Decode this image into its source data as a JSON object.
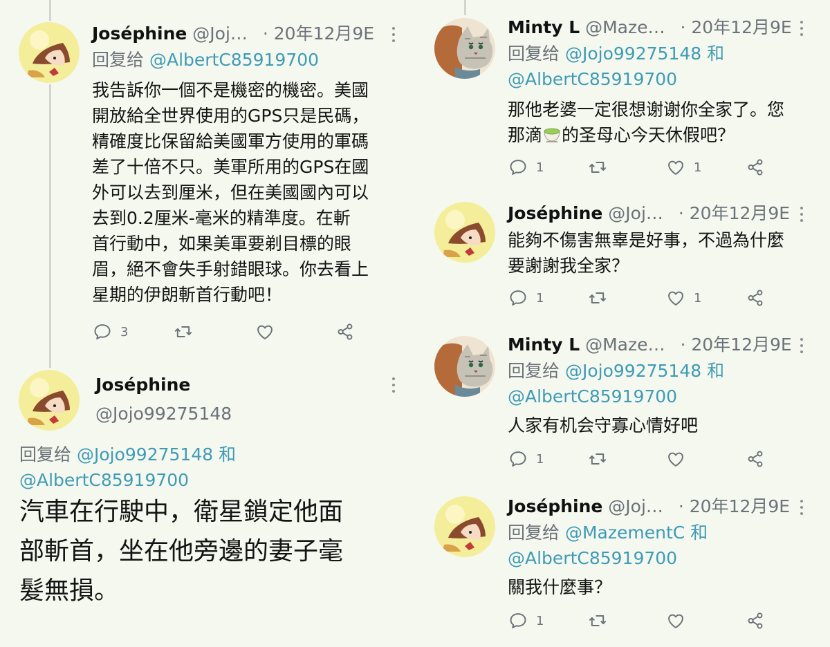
{
  "left_top": {
    "author_name": "Joséphine",
    "author_handle": "@Joj…",
    "date": "· 20年12月9E",
    "reply_prefix": "回复给",
    "reply_to": "@AlbertC85919700",
    "lines": [
      "我告訴你一個不是機密的機密。美國",
      "開放給全世界使用的GPS只是民碼，",
      "精確度比保留給美國軍方使用的軍碼",
      "差了十倍不只。美軍所用的GPS在國",
      "外可以去到厘米，但在美國國內可以",
      "去到0.2厘米-毫米的精準度。在斬",
      "首行動中，如果美軍要剃目標的眼",
      "眉，絕不會失手射錯眼球。你去看上",
      "星期的伊朗斬首行動吧！"
    ],
    "reply_count": "3"
  },
  "left_bottom": {
    "author_name": "Joséphine",
    "author_handle": "@Jojo99275148",
    "reply_prefix": "回复给",
    "reply_to_1": "@Jojo99275148",
    "and_word": "和",
    "reply_to_2": "@AlbertC85919700",
    "lines": [
      "汽車在行駛中，衛星鎖定他面",
      "部斬首，坐在他旁邊的妻子毫",
      "髮無損。"
    ]
  },
  "right_1": {
    "author_name": "Minty L",
    "author_handle": "@Maze…",
    "date": "· 20年12月9E",
    "reply_prefix": "回复给",
    "reply_to_1": "@Jojo99275148",
    "and_word": "和",
    "reply_to_2": "@AlbertC85919700",
    "line_1": "那他老婆一定很想谢谢你全家了。您",
    "line_2a": "那滴",
    "line_2b": "的圣母心今天休假吧？",
    "reply_count": "1",
    "like_count": "1"
  },
  "right_2": {
    "author_name": "Joséphine",
    "author_handle": "@Joj…",
    "date": "· 20年12月9E",
    "lines": [
      "能夠不傷害無辜是好事，不過為什麼",
      "要謝謝我全家？"
    ],
    "reply_count": "1",
    "like_count": "1"
  },
  "right_3": {
    "author_name": "Minty L",
    "author_handle": "@Maze…",
    "date": "· 20年12月9E",
    "reply_prefix": "回复给",
    "reply_to_1": "@Jojo99275148",
    "and_word": "和",
    "reply_to_2": "@AlbertC85919700",
    "line_1": "人家有机会守寡心情好吧",
    "reply_count": "1"
  },
  "right_4": {
    "author_name": "Joséphine",
    "author_handle": "@Joj…",
    "date": "· 20年12月9E",
    "reply_prefix": "回复给",
    "reply_to_1": "@MazementC",
    "and_word": "和",
    "reply_to_2": "@AlbertC85919700",
    "line_1": "關我什麼事？",
    "reply_count": "1"
  },
  "icons": {
    "reply": "speech-bubble-icon",
    "retweet": "retweet-arrows-icon",
    "like": "heart-icon",
    "share": "share-nodes-icon",
    "more": "vertical-ellipsis-icon",
    "emoji": "matcha-cup-emoji"
  },
  "colors": {
    "background": "#f5f8ee",
    "link": "#3e9bb6",
    "muted": "#6a737a",
    "thread_line": "#cfd6cf"
  }
}
